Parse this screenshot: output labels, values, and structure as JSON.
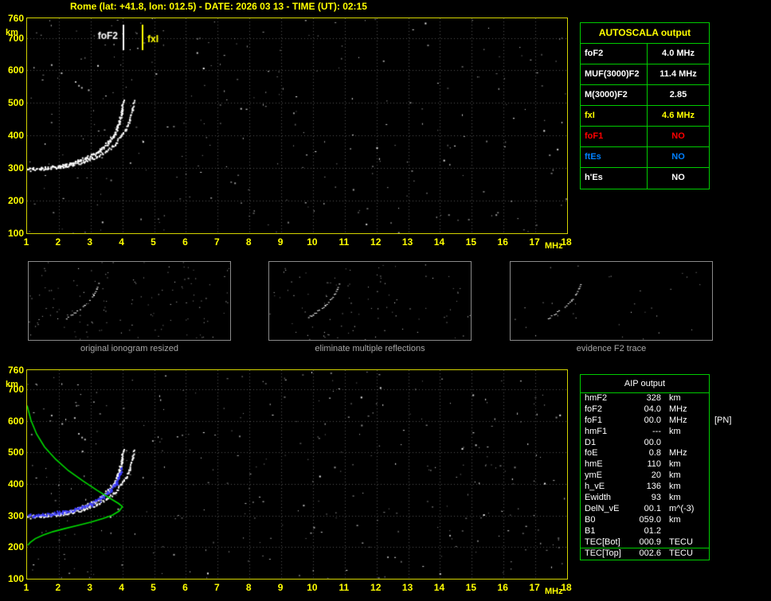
{
  "header": {
    "title": "Rome (lat: +41.8, lon: 012.5) - DATE: 2026 03 13 - TIME (UT): 02:15"
  },
  "colors": {
    "background": "#000000",
    "axis_yellow": "#ffff00",
    "plot_border": "#d4d400",
    "table_border": "#00cc00",
    "caption_gray": "#a8a8a8",
    "trace_white": "#ffffff",
    "restored_trace_blue": "#3a3aff",
    "profile_green": "#00dd00",
    "no_red": "#ff0000",
    "no_blue": "#0080ff"
  },
  "autoscala": {
    "title": "AUTOSCALA output",
    "rows": [
      {
        "label": "foF2",
        "value": "4.0 MHz",
        "color": "#ffffff"
      },
      {
        "label": "MUF(3000)F2",
        "value": "11.4 MHz",
        "color": "#ffffff"
      },
      {
        "label": "M(3000)F2",
        "value": "2.85",
        "color": "#ffffff"
      },
      {
        "label": "fxI",
        "value": "4.6 MHz",
        "color": "#ffff00"
      },
      {
        "label": "foF1",
        "value": "NO",
        "color": "#ff0000"
      },
      {
        "label": "ftEs",
        "value": "NO",
        "color": "#0080ff"
      },
      {
        "label": "h'Es",
        "value": "NO",
        "color": "#ffffff"
      }
    ]
  },
  "thumbnails": [
    {
      "caption": "original ionogram resized"
    },
    {
      "caption": "eliminate multiple reflections"
    },
    {
      "caption": "evidence F2 trace"
    }
  ],
  "aip": {
    "title": "AIP output",
    "rows": [
      {
        "label": "hmF2",
        "value": "328",
        "unit": "km",
        "note": ""
      },
      {
        "label": "foF2",
        "value": "04.0",
        "unit": "MHz",
        "note": ""
      },
      {
        "label": "foF1",
        "value": "00.0",
        "unit": "MHz",
        "note": "[PN]"
      },
      {
        "label": "hmF1",
        "value": "---",
        "unit": "km",
        "note": ""
      },
      {
        "label": "D1",
        "value": "00.0",
        "unit": "",
        "note": ""
      },
      {
        "label": "foE",
        "value": "0.8",
        "unit": "MHz",
        "note": ""
      },
      {
        "label": "hmE",
        "value": "110",
        "unit": "km",
        "note": ""
      },
      {
        "label": "ymE",
        "value": "20",
        "unit": "km",
        "note": ""
      },
      {
        "label": "h_vE",
        "value": "136",
        "unit": "km",
        "note": ""
      },
      {
        "label": "Ewidth",
        "value": "93",
        "unit": "km",
        "note": ""
      },
      {
        "label": "DelN_vE",
        "value": "00.1",
        "unit": "m^(-3)",
        "note": ""
      },
      {
        "label": "B0",
        "value": "059.0",
        "unit": "km",
        "note": ""
      },
      {
        "label": "B1",
        "value": "01.2",
        "unit": "",
        "note": ""
      },
      {
        "label": "TEC[Bot]",
        "value": "000.9",
        "unit": "TECU",
        "note": ""
      },
      {
        "label": "TEC[Top]",
        "value": "002.6",
        "unit": "TECU",
        "note": ""
      }
    ]
  },
  "chart_data": [
    {
      "id": "ionogram-top",
      "type": "scatter",
      "title": "ionogram with autoscaled characteristics",
      "xlabel": "MHz",
      "ylabel": "km",
      "xlim": [
        1,
        18
      ],
      "ylim": [
        100,
        760
      ],
      "x_ticks": [
        1,
        2,
        3,
        4,
        5,
        6,
        7,
        8,
        9,
        10,
        11,
        12,
        13,
        14,
        15,
        16,
        17,
        18
      ],
      "y_ticks": [
        760,
        700,
        600,
        500,
        400,
        300,
        200,
        100
      ],
      "grid": true,
      "series": [
        {
          "name": "F2 ordinary trace",
          "color": "#ffffff",
          "style": "speckle-thick",
          "points": [
            [
              1.0,
              298
            ],
            [
              1.4,
              300
            ],
            [
              1.8,
              304
            ],
            [
              2.2,
              311
            ],
            [
              2.6,
              322
            ],
            [
              3.0,
              338
            ],
            [
              3.3,
              357
            ],
            [
              3.55,
              380
            ],
            [
              3.75,
              407
            ],
            [
              3.88,
              437
            ],
            [
              3.95,
              468
            ],
            [
              4.0,
              505
            ]
          ]
        },
        {
          "name": "F2 extraordinary trace",
          "color": "#ffffff",
          "style": "speckle",
          "points": [
            [
              2.0,
              303
            ],
            [
              2.4,
              310
            ],
            [
              2.8,
              321
            ],
            [
              3.2,
              336
            ],
            [
              3.5,
              354
            ],
            [
              3.75,
              375
            ],
            [
              3.95,
              399
            ],
            [
              4.1,
              424
            ],
            [
              4.22,
              452
            ],
            [
              4.3,
              480
            ],
            [
              4.35,
              508
            ]
          ]
        },
        {
          "name": "echo remnant",
          "color": "#bbbbbb",
          "style": "sparse",
          "points": [
            [
              1.65,
              630
            ],
            [
              2.0,
              600
            ],
            [
              2.4,
              570
            ],
            [
              2.9,
              540
            ]
          ]
        }
      ],
      "markers": [
        {
          "label": "foF2",
          "freq": 4.0,
          "color": "#ffffff",
          "side": "left"
        },
        {
          "label": "fxI",
          "freq": 4.6,
          "color": "#ffff00",
          "side": "right"
        }
      ],
      "noise": {
        "count": 270,
        "seed": 11
      }
    },
    {
      "id": "ionogram-bottom",
      "type": "scatter",
      "title": "ionogram with restored trace and electron density profile",
      "xlabel": "MHz",
      "ylabel": "km",
      "xlim": [
        1,
        18
      ],
      "ylim": [
        100,
        760
      ],
      "x_ticks": [
        1,
        2,
        3,
        4,
        5,
        6,
        7,
        8,
        9,
        10,
        11,
        12,
        13,
        14,
        15,
        16,
        17,
        18
      ],
      "y_ticks": [
        760,
        700,
        600,
        500,
        400,
        300,
        200,
        100
      ],
      "grid": true,
      "series": [
        {
          "name": "F2 ordinary trace",
          "color": "#ffffff",
          "style": "speckle-thick",
          "points": [
            [
              1.0,
              298
            ],
            [
              1.4,
              300
            ],
            [
              1.8,
              304
            ],
            [
              2.2,
              311
            ],
            [
              2.6,
              322
            ],
            [
              3.0,
              338
            ],
            [
              3.3,
              357
            ],
            [
              3.55,
              380
            ],
            [
              3.75,
              407
            ],
            [
              3.88,
              437
            ],
            [
              3.95,
              468
            ],
            [
              4.0,
              505
            ]
          ]
        },
        {
          "name": "F2 extraordinary trace",
          "color": "#ffffff",
          "style": "speckle",
          "points": [
            [
              2.0,
              303
            ],
            [
              2.4,
              310
            ],
            [
              2.8,
              321
            ],
            [
              3.2,
              336
            ],
            [
              3.5,
              354
            ],
            [
              3.75,
              375
            ],
            [
              3.95,
              399
            ],
            [
              4.1,
              424
            ],
            [
              4.22,
              452
            ],
            [
              4.3,
              480
            ],
            [
              4.35,
              508
            ]
          ]
        },
        {
          "name": "echo remnant",
          "color": "#bbbbbb",
          "style": "sparse",
          "points": [
            [
              1.65,
              630
            ],
            [
              2.0,
              600
            ],
            [
              2.4,
              570
            ],
            [
              2.9,
              540
            ]
          ]
        },
        {
          "name": "restored F2 trace",
          "color": "#3a3aff",
          "style": "speckle-thick",
          "points": [
            [
              1.0,
              300
            ],
            [
              1.5,
              303
            ],
            [
              2.0,
              310
            ],
            [
              2.5,
              320
            ],
            [
              3.0,
              337
            ],
            [
              3.3,
              355
            ],
            [
              3.6,
              379
            ],
            [
              3.8,
              406
            ],
            [
              3.9,
              430
            ],
            [
              3.97,
              452
            ]
          ]
        },
        {
          "name": "electron density profile",
          "color": "#00dd00",
          "style": "line",
          "points": [
            [
              1.0,
              648
            ],
            [
              1.12,
              602
            ],
            [
              1.3,
              558
            ],
            [
              1.55,
              517
            ],
            [
              1.9,
              478
            ],
            [
              2.3,
              442
            ],
            [
              2.75,
              410
            ],
            [
              3.2,
              380
            ],
            [
              3.6,
              355
            ],
            [
              3.88,
              338
            ],
            [
              4.0,
              328
            ],
            [
              3.9,
              314
            ],
            [
              3.68,
              301
            ],
            [
              3.38,
              290
            ],
            [
              3.0,
              279
            ],
            [
              2.6,
              269
            ],
            [
              2.2,
              259
            ],
            [
              1.82,
              249
            ],
            [
              1.5,
              238
            ],
            [
              1.26,
              227
            ],
            [
              1.1,
              215
            ],
            [
              1.02,
              206
            ]
          ]
        }
      ],
      "markers": [],
      "noise": {
        "count": 310,
        "seed": 23
      }
    },
    {
      "id": "thumb-0",
      "type": "scatter",
      "trace": [
        [
          0.185,
          0.72
        ],
        [
          0.215,
          0.67
        ],
        [
          0.245,
          0.615
        ],
        [
          0.275,
          0.555
        ],
        [
          0.3,
          0.49
        ],
        [
          0.32,
          0.42
        ],
        [
          0.335,
          0.35
        ],
        [
          0.345,
          0.28
        ]
      ],
      "noise": {
        "count": 130,
        "seed": 5
      }
    },
    {
      "id": "thumb-1",
      "type": "scatter",
      "trace": [
        [
          0.185,
          0.72
        ],
        [
          0.215,
          0.67
        ],
        [
          0.245,
          0.615
        ],
        [
          0.275,
          0.555
        ],
        [
          0.3,
          0.49
        ],
        [
          0.32,
          0.42
        ],
        [
          0.335,
          0.35
        ],
        [
          0.345,
          0.28
        ]
      ],
      "noise": {
        "count": 95,
        "seed": 6
      }
    },
    {
      "id": "thumb-2",
      "type": "scatter",
      "trace": [
        [
          0.185,
          0.72
        ],
        [
          0.215,
          0.67
        ],
        [
          0.245,
          0.615
        ],
        [
          0.275,
          0.555
        ],
        [
          0.3,
          0.49
        ],
        [
          0.32,
          0.42
        ],
        [
          0.335,
          0.35
        ],
        [
          0.345,
          0.28
        ]
      ],
      "noise": {
        "count": 30,
        "seed": 9
      }
    }
  ]
}
